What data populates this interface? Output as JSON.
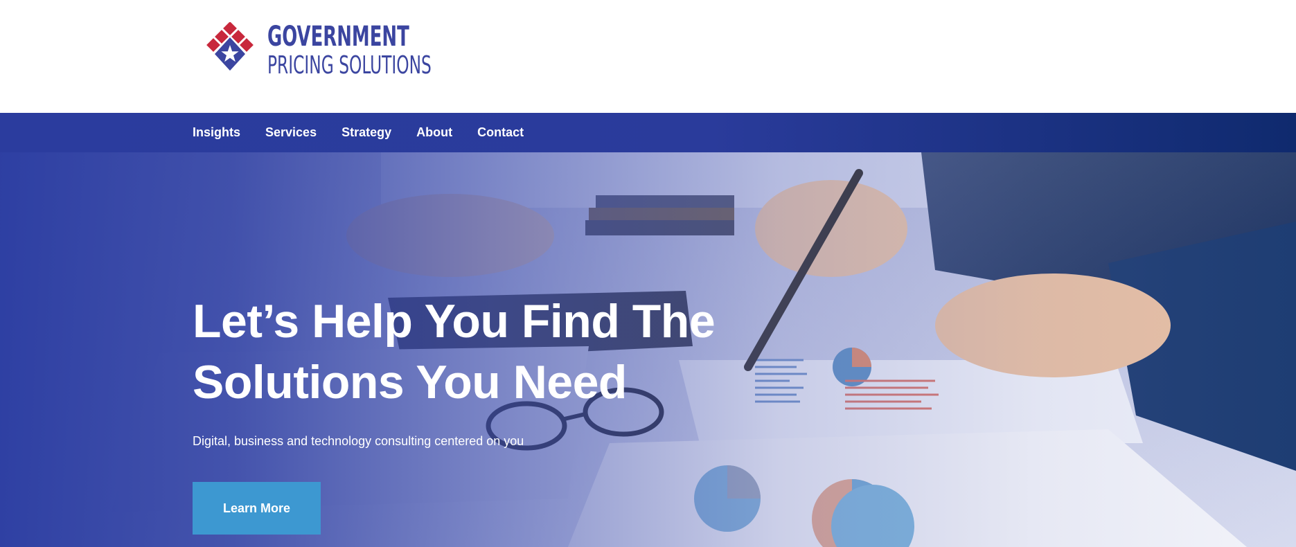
{
  "header": {
    "logo": {
      "line1": "GOVERNMENT",
      "line2": "PRICING SOLUTIONS",
      "color": "#3b45a0",
      "mark_colors": {
        "red": "#c8283c",
        "blue": "#3b45a0"
      }
    }
  },
  "nav": {
    "items": [
      {
        "label": "Insights"
      },
      {
        "label": "Services"
      },
      {
        "label": "Strategy"
      },
      {
        "label": "About"
      },
      {
        "label": "Contact"
      }
    ]
  },
  "hero": {
    "title_line1": "Let’s Help You Find The",
    "title_line2": "Solutions You Need",
    "subtitle": "Digital, business and technology consulting centered on you",
    "cta_label": "Learn More",
    "cta_color": "#3d98d1"
  }
}
